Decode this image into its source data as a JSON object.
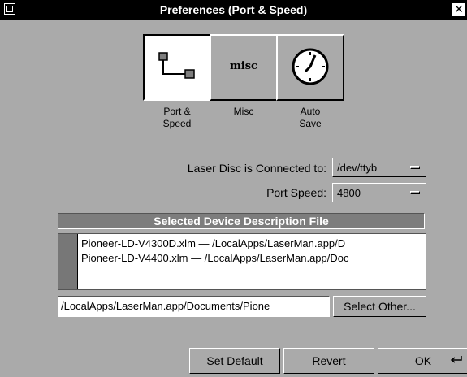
{
  "window": {
    "title": "Preferences (Port & Speed)"
  },
  "toolbar": [
    {
      "label": "Port & Speed",
      "icon": "port-speed-icon"
    },
    {
      "label": "Misc",
      "glyph": "misc",
      "icon": "misc-icon"
    },
    {
      "label": "Auto Save",
      "icon": "clock-icon"
    }
  ],
  "port": {
    "connected_label": "Laser Disc is Connected to:",
    "connected_value": "/dev/ttyb",
    "speed_label": "Port Speed:",
    "speed_value": "4800"
  },
  "device_section": {
    "header": "Selected Device Description File",
    "items": [
      "Pioneer-LD-V4300D.xlm — /LocalApps/LaserMan.app/D",
      "Pioneer-LD-V4400.xlm — /LocalApps/LaserMan.app/Doc"
    ],
    "path_value": "/LocalApps/LaserMan.app/Documents/Pione",
    "select_other_label": "Select Other..."
  },
  "footer": {
    "set_default_label": "Set Default",
    "revert_label": "Revert",
    "ok_label": "OK"
  }
}
